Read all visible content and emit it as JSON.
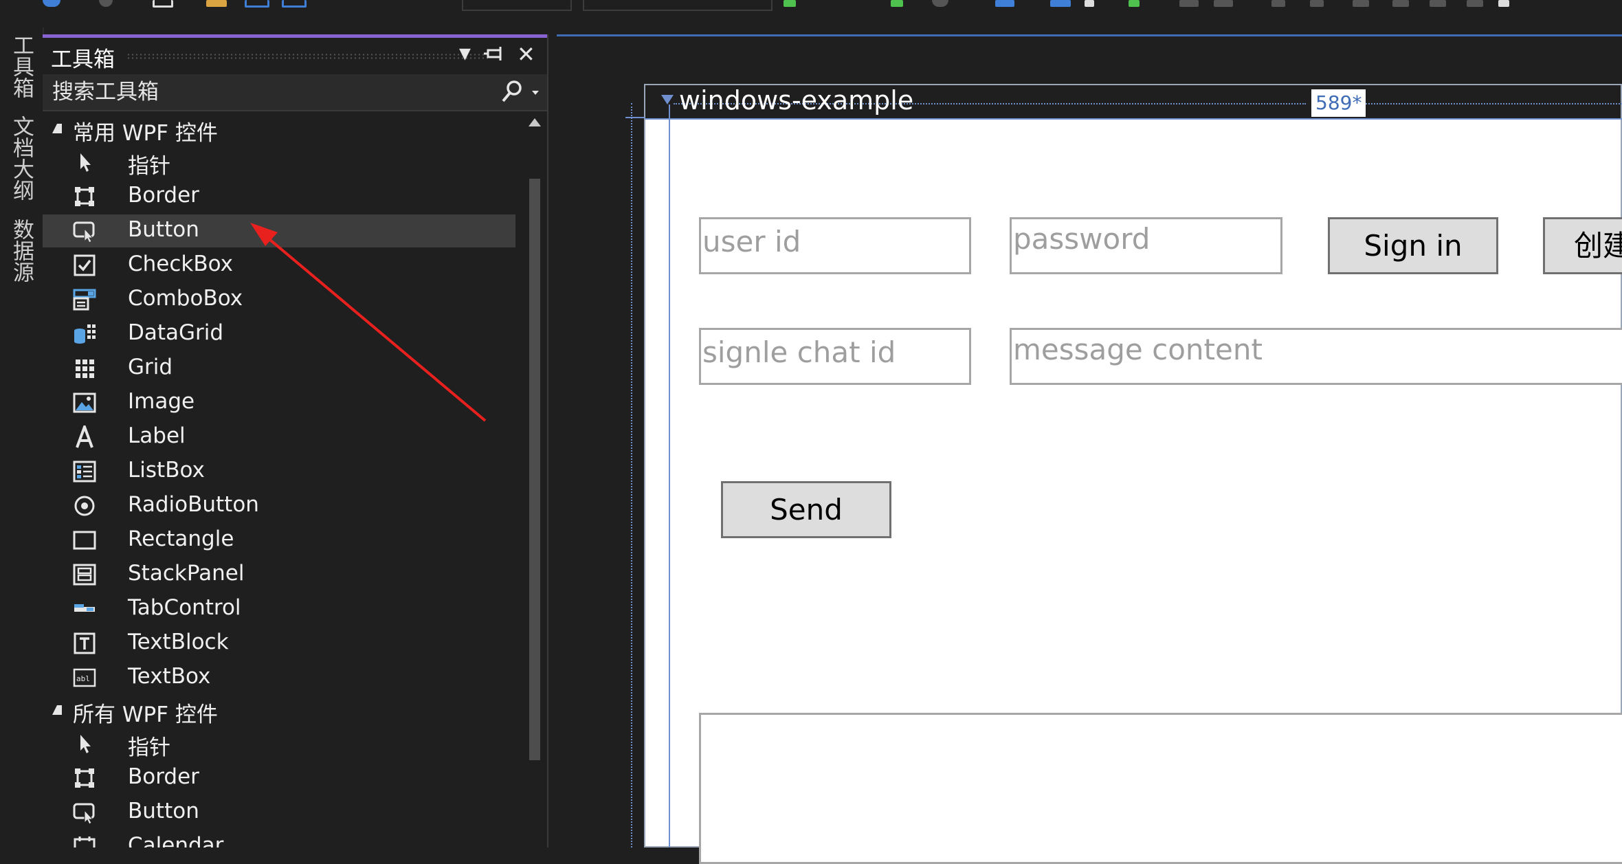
{
  "toolbox": {
    "title": "工具箱",
    "search_placeholder": "搜索工具箱",
    "groups": [
      {
        "label": "常用 WPF 控件"
      },
      {
        "label": "所有 WPF 控件"
      }
    ],
    "common_items": [
      {
        "label": "指针",
        "icon": "pointer-icon"
      },
      {
        "label": "Border",
        "icon": "border-icon"
      },
      {
        "label": "Button",
        "icon": "button-icon"
      },
      {
        "label": "CheckBox",
        "icon": "checkbox-icon"
      },
      {
        "label": "ComboBox",
        "icon": "combobox-icon"
      },
      {
        "label": "DataGrid",
        "icon": "datagrid-icon"
      },
      {
        "label": "Grid",
        "icon": "grid-icon"
      },
      {
        "label": "Image",
        "icon": "image-icon"
      },
      {
        "label": "Label",
        "icon": "label-icon"
      },
      {
        "label": "ListBox",
        "icon": "listbox-icon"
      },
      {
        "label": "RadioButton",
        "icon": "radiobutton-icon"
      },
      {
        "label": "Rectangle",
        "icon": "rectangle-icon"
      },
      {
        "label": "StackPanel",
        "icon": "stackpanel-icon"
      },
      {
        "label": "TabControl",
        "icon": "tabcontrol-icon"
      },
      {
        "label": "TextBlock",
        "icon": "textblock-icon"
      },
      {
        "label": "TextBox",
        "icon": "textbox-icon"
      }
    ],
    "all_items": [
      {
        "label": "指针",
        "icon": "pointer-icon"
      },
      {
        "label": "Border",
        "icon": "border-icon"
      },
      {
        "label": "Button",
        "icon": "button-icon"
      },
      {
        "label": "Calendar",
        "icon": "calendar-icon"
      }
    ],
    "selected_item": "Button"
  },
  "side_tabs": [
    "工具箱",
    "文档大纲",
    "数据源"
  ],
  "designer": {
    "window_title": "windows-example",
    "width_badge": "589*",
    "fields": {
      "user_id": "user id",
      "password": "password",
      "single_chat_id": "signle chat id",
      "message_content": "message content"
    },
    "buttons": {
      "sign_in": "Sign in",
      "create": "创建",
      "send": "Send"
    }
  },
  "colors": {
    "accent": "#8a63d2",
    "selection": "#3d3d3d",
    "designer_guide": "#6f8fcf",
    "annotation_arrow": "#e8201e"
  }
}
